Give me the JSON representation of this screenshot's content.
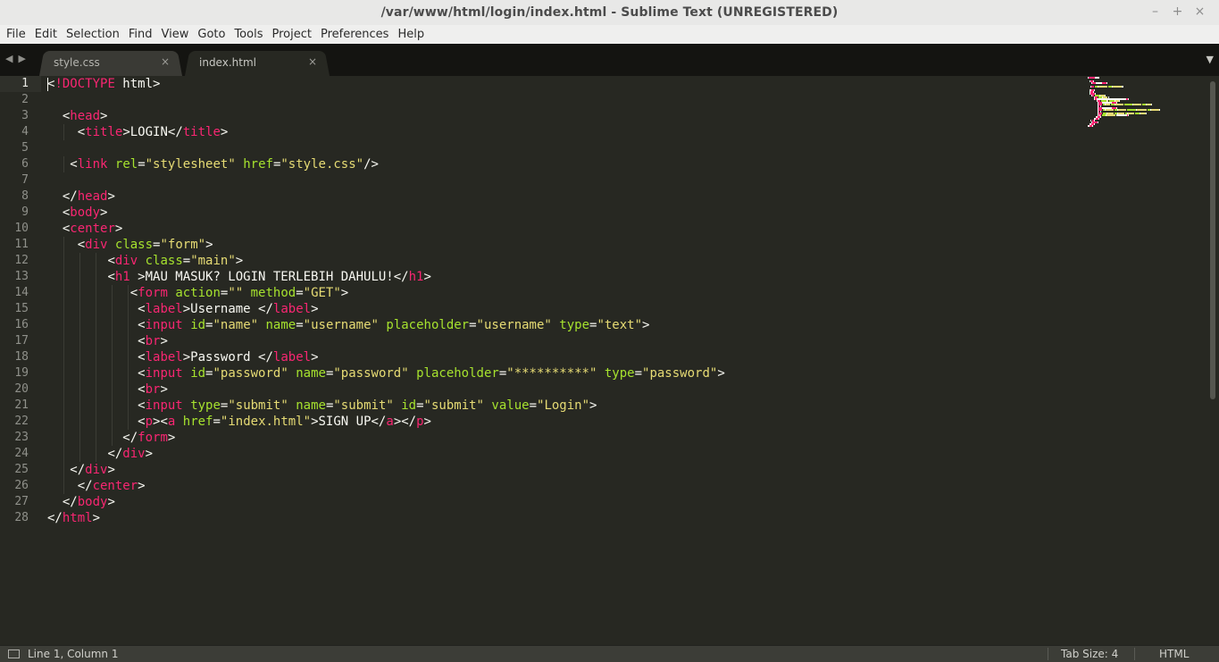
{
  "window": {
    "title": "/var/www/html/login/index.html - Sublime Text (UNREGISTERED)",
    "controls": [
      "–",
      "+",
      "×"
    ]
  },
  "menu": [
    "File",
    "Edit",
    "Selection",
    "Find",
    "View",
    "Goto",
    "Tools",
    "Project",
    "Preferences",
    "Help"
  ],
  "tabs": [
    {
      "label": "style.css",
      "active": false
    },
    {
      "label": "index.html",
      "active": true
    }
  ],
  "editor": {
    "active_line": 1,
    "lines": [
      {
        "n": "1",
        "indent": "",
        "tokens": [
          [
            "pl",
            "<"
          ],
          [
            "tg",
            "!DOCTYPE"
          ],
          [
            "pl",
            " html>"
          ]
        ]
      },
      {
        "n": "2",
        "indent": "",
        "tokens": []
      },
      {
        "n": "3",
        "indent": "  ",
        "tokens": [
          [
            "pl",
            "<"
          ],
          [
            "tg",
            "head"
          ],
          [
            "pl",
            ">"
          ]
        ]
      },
      {
        "n": "4",
        "indent": "    ",
        "tokens": [
          [
            "pl",
            "<"
          ],
          [
            "tg",
            "title"
          ],
          [
            "pl",
            ">LOGIN</"
          ],
          [
            "tg",
            "title"
          ],
          [
            "pl",
            ">"
          ]
        ]
      },
      {
        "n": "5",
        "indent": "",
        "tokens": []
      },
      {
        "n": "6",
        "indent": "   ",
        "tokens": [
          [
            "pl",
            "<"
          ],
          [
            "tg",
            "link"
          ],
          [
            "pl",
            " "
          ],
          [
            "at",
            "rel"
          ],
          [
            "pl",
            "="
          ],
          [
            "st",
            "\"stylesheet\""
          ],
          [
            "pl",
            " "
          ],
          [
            "at",
            "href"
          ],
          [
            "pl",
            "="
          ],
          [
            "st",
            "\"style.css\""
          ],
          [
            "pl",
            "/>"
          ]
        ]
      },
      {
        "n": "7",
        "indent": "",
        "tokens": []
      },
      {
        "n": "8",
        "indent": "  ",
        "tokens": [
          [
            "pl",
            "</"
          ],
          [
            "tg",
            "head"
          ],
          [
            "pl",
            ">"
          ]
        ]
      },
      {
        "n": "9",
        "indent": "  ",
        "tokens": [
          [
            "pl",
            "<"
          ],
          [
            "tg",
            "body"
          ],
          [
            "pl",
            ">"
          ]
        ]
      },
      {
        "n": "10",
        "indent": "  ",
        "tokens": [
          [
            "pl",
            "<"
          ],
          [
            "tg",
            "center"
          ],
          [
            "pl",
            ">"
          ]
        ]
      },
      {
        "n": "11",
        "indent": "    ",
        "tokens": [
          [
            "pl",
            "<"
          ],
          [
            "tg",
            "div"
          ],
          [
            "pl",
            " "
          ],
          [
            "at",
            "class"
          ],
          [
            "pl",
            "="
          ],
          [
            "st",
            "\"form\""
          ],
          [
            "pl",
            ">"
          ]
        ]
      },
      {
        "n": "12",
        "indent": "        ",
        "tokens": [
          [
            "pl",
            "<"
          ],
          [
            "tg",
            "div"
          ],
          [
            "pl",
            " "
          ],
          [
            "at",
            "class"
          ],
          [
            "pl",
            "="
          ],
          [
            "st",
            "\"main\""
          ],
          [
            "pl",
            ">"
          ]
        ]
      },
      {
        "n": "13",
        "indent": "        ",
        "tokens": [
          [
            "pl",
            "<"
          ],
          [
            "tg",
            "h1"
          ],
          [
            "pl",
            " >MAU MASUK? LOGIN TERLEBIH DAHULU!</"
          ],
          [
            "tg",
            "h1"
          ],
          [
            "pl",
            ">"
          ]
        ]
      },
      {
        "n": "14",
        "indent": "           ",
        "tokens": [
          [
            "pl",
            "<"
          ],
          [
            "tg",
            "form"
          ],
          [
            "pl",
            " "
          ],
          [
            "at",
            "action"
          ],
          [
            "pl",
            "="
          ],
          [
            "st",
            "\"\""
          ],
          [
            "pl",
            " "
          ],
          [
            "at",
            "method"
          ],
          [
            "pl",
            "="
          ],
          [
            "st",
            "\"GET\""
          ],
          [
            "pl",
            ">"
          ]
        ]
      },
      {
        "n": "15",
        "indent": "            ",
        "tokens": [
          [
            "pl",
            "<"
          ],
          [
            "tg",
            "label"
          ],
          [
            "pl",
            ">Username </"
          ],
          [
            "tg",
            "label"
          ],
          [
            "pl",
            ">"
          ]
        ]
      },
      {
        "n": "16",
        "indent": "            ",
        "tokens": [
          [
            "pl",
            "<"
          ],
          [
            "tg",
            "input"
          ],
          [
            "pl",
            " "
          ],
          [
            "at",
            "id"
          ],
          [
            "pl",
            "="
          ],
          [
            "st",
            "\"name\""
          ],
          [
            "pl",
            " "
          ],
          [
            "at",
            "name"
          ],
          [
            "pl",
            "="
          ],
          [
            "st",
            "\"username\""
          ],
          [
            "pl",
            " "
          ],
          [
            "at",
            "placeholder"
          ],
          [
            "pl",
            "="
          ],
          [
            "st",
            "\"username\""
          ],
          [
            "pl",
            " "
          ],
          [
            "at",
            "type"
          ],
          [
            "pl",
            "="
          ],
          [
            "st",
            "\"text\""
          ],
          [
            "pl",
            ">"
          ]
        ]
      },
      {
        "n": "17",
        "indent": "            ",
        "tokens": [
          [
            "pl",
            "<"
          ],
          [
            "tg",
            "br"
          ],
          [
            "pl",
            ">"
          ]
        ]
      },
      {
        "n": "18",
        "indent": "            ",
        "tokens": [
          [
            "pl",
            "<"
          ],
          [
            "tg",
            "label"
          ],
          [
            "pl",
            ">Password </"
          ],
          [
            "tg",
            "label"
          ],
          [
            "pl",
            ">"
          ]
        ]
      },
      {
        "n": "19",
        "indent": "            ",
        "tokens": [
          [
            "pl",
            "<"
          ],
          [
            "tg",
            "input"
          ],
          [
            "pl",
            " "
          ],
          [
            "at",
            "id"
          ],
          [
            "pl",
            "="
          ],
          [
            "st",
            "\"password\""
          ],
          [
            "pl",
            " "
          ],
          [
            "at",
            "name"
          ],
          [
            "pl",
            "="
          ],
          [
            "st",
            "\"password\""
          ],
          [
            "pl",
            " "
          ],
          [
            "at",
            "placeholder"
          ],
          [
            "pl",
            "="
          ],
          [
            "st",
            "\"**********\""
          ],
          [
            "pl",
            " "
          ],
          [
            "at",
            "type"
          ],
          [
            "pl",
            "="
          ],
          [
            "st",
            "\"password\""
          ],
          [
            "pl",
            ">"
          ]
        ]
      },
      {
        "n": "20",
        "indent": "            ",
        "tokens": [
          [
            "pl",
            "<"
          ],
          [
            "tg",
            "br"
          ],
          [
            "pl",
            ">"
          ]
        ]
      },
      {
        "n": "21",
        "indent": "            ",
        "tokens": [
          [
            "pl",
            "<"
          ],
          [
            "tg",
            "input"
          ],
          [
            "pl",
            " "
          ],
          [
            "at",
            "type"
          ],
          [
            "pl",
            "="
          ],
          [
            "st",
            "\"submit\""
          ],
          [
            "pl",
            " "
          ],
          [
            "at",
            "name"
          ],
          [
            "pl",
            "="
          ],
          [
            "st",
            "\"submit\""
          ],
          [
            "pl",
            " "
          ],
          [
            "at",
            "id"
          ],
          [
            "pl",
            "="
          ],
          [
            "st",
            "\"submit\""
          ],
          [
            "pl",
            " "
          ],
          [
            "at",
            "value"
          ],
          [
            "pl",
            "="
          ],
          [
            "st",
            "\"Login\""
          ],
          [
            "pl",
            ">"
          ]
        ]
      },
      {
        "n": "22",
        "indent": "            ",
        "tokens": [
          [
            "pl",
            "<"
          ],
          [
            "tg",
            "p"
          ],
          [
            "pl",
            "><"
          ],
          [
            "tg",
            "a"
          ],
          [
            "pl",
            " "
          ],
          [
            "at",
            "href"
          ],
          [
            "pl",
            "="
          ],
          [
            "st",
            "\"index.html\""
          ],
          [
            "pl",
            ">SIGN UP</"
          ],
          [
            "tg",
            "a"
          ],
          [
            "pl",
            "></"
          ],
          [
            "tg",
            "p"
          ],
          [
            "pl",
            ">"
          ]
        ]
      },
      {
        "n": "23",
        "indent": "          ",
        "tokens": [
          [
            "pl",
            "</"
          ],
          [
            "tg",
            "form"
          ],
          [
            "pl",
            ">"
          ]
        ]
      },
      {
        "n": "24",
        "indent": "        ",
        "tokens": [
          [
            "pl",
            "</"
          ],
          [
            "tg",
            "div"
          ],
          [
            "pl",
            ">"
          ]
        ]
      },
      {
        "n": "25",
        "indent": "   ",
        "tokens": [
          [
            "pl",
            "</"
          ],
          [
            "tg",
            "div"
          ],
          [
            "pl",
            ">"
          ]
        ]
      },
      {
        "n": "26",
        "indent": "    ",
        "tokens": [
          [
            "pl",
            "</"
          ],
          [
            "tg",
            "center"
          ],
          [
            "pl",
            ">"
          ]
        ]
      },
      {
        "n": "27",
        "indent": "  ",
        "tokens": [
          [
            "pl",
            "</"
          ],
          [
            "tg",
            "body"
          ],
          [
            "pl",
            ">"
          ]
        ]
      },
      {
        "n": "28",
        "indent": "",
        "tokens": [
          [
            "pl",
            "</"
          ],
          [
            "tg",
            "html"
          ],
          [
            "pl",
            ">"
          ]
        ]
      }
    ]
  },
  "status": {
    "position": "Line 1, Column 1",
    "tab_size": "Tab Size: 4",
    "syntax": "HTML"
  },
  "colors": {
    "background": "#272822",
    "tag": "#f92672",
    "attribute": "#a6e22e",
    "string": "#e6db74",
    "text": "#f8f8f2"
  }
}
